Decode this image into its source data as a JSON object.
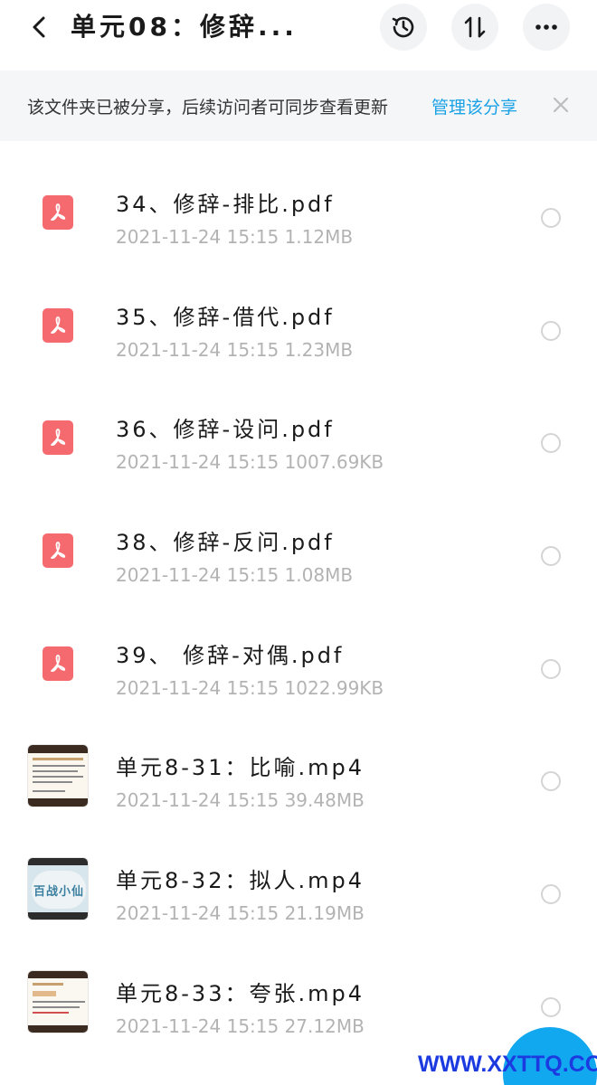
{
  "header": {
    "title": "单元08：修辞...",
    "back_icon": "chevron-left-icon",
    "history_icon": "history-icon",
    "sort_icon": "sort-icon",
    "more_icon": "more-icon"
  },
  "banner": {
    "text": "该文件夹已被分享，后续访问者可同步查看更新",
    "link": "管理该分享",
    "close_icon": "close-icon"
  },
  "files": [
    {
      "name": "34、修辞-排比.pdf",
      "meta": "2021-11-24  15:15  1.12MB",
      "type": "pdf"
    },
    {
      "name": "35、修辞-借代.pdf",
      "meta": "2021-11-24  15:15  1.23MB",
      "type": "pdf"
    },
    {
      "name": "36、修辞-设问.pdf",
      "meta": "2021-11-24  15:15  1007.69KB",
      "type": "pdf"
    },
    {
      "name": "38、修辞-反问.pdf",
      "meta": "2021-11-24  15:15  1.08MB",
      "type": "pdf"
    },
    {
      "name": "39、 修辞-对偶.pdf",
      "meta": "2021-11-24  15:15  1022.99KB",
      "type": "pdf"
    },
    {
      "name": "单元8-31：比喻.mp4",
      "meta": "2021-11-24  15:15  39.48MB",
      "type": "video"
    },
    {
      "name": "单元8-32：拟人.mp4",
      "meta": "2021-11-24  15:15  21.19MB",
      "type": "video",
      "thumb_text": "百战小仙"
    },
    {
      "name": "单元8-33：夸张.mp4",
      "meta": "2021-11-24  15:15  27.12MB",
      "type": "video"
    }
  ],
  "watermark": "WWW.XXTTQ.COM",
  "colors": {
    "accent": "#1aa2e6",
    "pdf": "#f56a6e",
    "fab": "#12a8f0",
    "watermark": "#1b3ae0"
  }
}
